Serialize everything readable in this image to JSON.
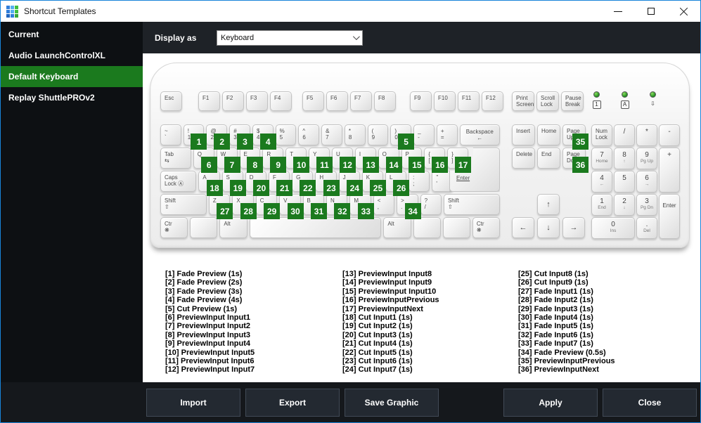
{
  "window": {
    "title": "Shortcut Templates"
  },
  "icon_squares": [
    "#2f7edb",
    "#55aef0",
    "#3fbf3f",
    "#2f7edb",
    "#55aef0",
    "#3fbf3f",
    "#1f66c0",
    "#2f7edb",
    "#37a837"
  ],
  "colors": {
    "accent_green": "#1b7a1e",
    "window_border": "#1884d9",
    "badge_green": "#1b7a1e"
  },
  "sidebar": {
    "items": [
      {
        "label": "Current",
        "selected": false
      },
      {
        "label": "Audio LaunchControlXL",
        "selected": false
      },
      {
        "label": "Default Keyboard",
        "selected": true
      },
      {
        "label": "Replay ShuttlePROv2",
        "selected": false
      }
    ]
  },
  "toolbar": {
    "display_as_label": "Display as",
    "display_as_value": "Keyboard"
  },
  "keyboard": {
    "esc": {
      "lines": [
        "Esc"
      ],
      "name": "esc"
    },
    "function_groups": [
      [
        {
          "lines": [
            "F1"
          ]
        },
        {
          "lines": [
            "F2"
          ]
        },
        {
          "lines": [
            "F3"
          ]
        },
        {
          "lines": [
            "F4"
          ]
        }
      ],
      [
        {
          "lines": [
            "F5"
          ]
        },
        {
          "lines": [
            "F6"
          ]
        },
        {
          "lines": [
            "F7"
          ]
        },
        {
          "lines": [
            "F8"
          ]
        }
      ],
      [
        {
          "lines": [
            "F9"
          ]
        },
        {
          "lines": [
            "F10"
          ]
        },
        {
          "lines": [
            "F11"
          ]
        },
        {
          "lines": [
            "F12"
          ]
        }
      ]
    ],
    "system_keys": [
      {
        "lines": [
          "Print",
          "Screen"
        ],
        "name": "print-screen"
      },
      {
        "lines": [
          "Scroll",
          "Lock"
        ],
        "name": "scroll-lock"
      },
      {
        "lines": [
          "Pause",
          "Break"
        ],
        "name": "pause-break"
      }
    ],
    "leds": [
      {
        "symbol": "1",
        "boxed": true,
        "name": "num-lock-led"
      },
      {
        "symbol": "A",
        "boxed": true,
        "name": "caps-lock-led"
      },
      {
        "symbol": "⇩",
        "boxed": false,
        "name": "scroll-lock-led"
      }
    ],
    "main_rows": [
      [
        {
          "lines": [
            "~",
            "`"
          ],
          "w": 1,
          "name": "backtick"
        },
        {
          "lines": [
            "!",
            "1"
          ],
          "w": 1,
          "badge": "1"
        },
        {
          "lines": [
            "@",
            "2"
          ],
          "w": 1,
          "badge": "2"
        },
        {
          "lines": [
            "#",
            "3"
          ],
          "w": 1,
          "badge": "3"
        },
        {
          "lines": [
            "$",
            "4"
          ],
          "w": 1,
          "badge": "4"
        },
        {
          "lines": [
            "%",
            "5"
          ],
          "w": 1
        },
        {
          "lines": [
            "^",
            "6"
          ],
          "w": 1
        },
        {
          "lines": [
            "&",
            "7"
          ],
          "w": 1
        },
        {
          "lines": [
            "*",
            "8"
          ],
          "w": 1
        },
        {
          "lines": [
            "(",
            "9"
          ],
          "w": 1
        },
        {
          "lines": [
            ")",
            "0"
          ],
          "w": 1,
          "badge": "5"
        },
        {
          "lines": [
            "_",
            "-"
          ],
          "w": 1,
          "name": "minus"
        },
        {
          "lines": [
            "+",
            "="
          ],
          "w": 1,
          "name": "equals"
        },
        {
          "lines": [
            "Backspace",
            "←"
          ],
          "w": 2,
          "center": true,
          "name": "backspace"
        }
      ],
      [
        {
          "lines": [
            "Tab",
            "⇆"
          ],
          "w": 1.5,
          "name": "tab"
        },
        {
          "lines": [
            "Q"
          ],
          "w": 1,
          "badge": "6"
        },
        {
          "lines": [
            "W"
          ],
          "w": 1,
          "badge": "7"
        },
        {
          "lines": [
            "E"
          ],
          "w": 1,
          "badge": "8"
        },
        {
          "lines": [
            "R"
          ],
          "w": 1,
          "badge": "9"
        },
        {
          "lines": [
            "T"
          ],
          "w": 1,
          "badge": "10"
        },
        {
          "lines": [
            "Y"
          ],
          "w": 1,
          "badge": "11"
        },
        {
          "lines": [
            "U"
          ],
          "w": 1,
          "badge": "12"
        },
        {
          "lines": [
            "I"
          ],
          "w": 1,
          "badge": "13"
        },
        {
          "lines": [
            "O"
          ],
          "w": 1,
          "badge": "14"
        },
        {
          "lines": [
            "P"
          ],
          "w": 1,
          "badge": "15"
        },
        {
          "lines": [
            "{",
            "["
          ],
          "w": 1,
          "badge": "16",
          "name": "lbracket"
        },
        {
          "lines": [
            "}",
            "]"
          ],
          "w": 1,
          "badge": "17",
          "name": "rbracket"
        },
        {
          "spacer": true,
          "w": 1.5
        }
      ],
      [
        {
          "lines": [
            "Caps",
            "Lock Ⓐ"
          ],
          "w": 1.75,
          "name": "caps-lock"
        },
        {
          "lines": [
            "A"
          ],
          "w": 1,
          "badge": "18"
        },
        {
          "lines": [
            "S"
          ],
          "w": 1,
          "badge": "19"
        },
        {
          "lines": [
            "D"
          ],
          "w": 1,
          "badge": "20"
        },
        {
          "lines": [
            "F"
          ],
          "w": 1,
          "badge": "21"
        },
        {
          "lines": [
            "G"
          ],
          "w": 1,
          "badge": "22"
        },
        {
          "lines": [
            "H"
          ],
          "w": 1,
          "badge": "23"
        },
        {
          "lines": [
            "J"
          ],
          "w": 1,
          "badge": "24"
        },
        {
          "lines": [
            "K"
          ],
          "w": 1,
          "badge": "25"
        },
        {
          "lines": [
            "L"
          ],
          "w": 1,
          "badge": "26"
        },
        {
          "lines": [
            ":",
            ";"
          ],
          "w": 1,
          "name": "semicolon"
        },
        {
          "lines": [
            "\"",
            "'"
          ],
          "w": 1,
          "name": "quote"
        },
        {
          "spacer": true,
          "w": 2.25
        }
      ],
      [
        {
          "lines": [
            "Shift",
            "⇧"
          ],
          "w": 2.25,
          "name": "left-shift"
        },
        {
          "lines": [
            "Z"
          ],
          "w": 1,
          "badge": "27"
        },
        {
          "lines": [
            "X"
          ],
          "w": 1,
          "badge": "28"
        },
        {
          "lines": [
            "C"
          ],
          "w": 1,
          "badge": "29"
        },
        {
          "lines": [
            "V"
          ],
          "w": 1,
          "badge": "30"
        },
        {
          "lines": [
            "B"
          ],
          "w": 1,
          "badge": "31"
        },
        {
          "lines": [
            "N"
          ],
          "w": 1,
          "badge": "32"
        },
        {
          "lines": [
            "M"
          ],
          "w": 1,
          "badge": "33"
        },
        {
          "lines": [
            "<",
            ","
          ],
          "w": 1,
          "name": "comma"
        },
        {
          "lines": [
            ">",
            "."
          ],
          "w": 1,
          "badge": "34",
          "name": "period"
        },
        {
          "lines": [
            "?",
            "/"
          ],
          "w": 1,
          "name": "slash"
        },
        {
          "lines": [
            "Shift",
            "⇧"
          ],
          "w": 2.75,
          "name": "right-shift"
        }
      ],
      [
        {
          "lines": [
            "Ctr",
            "❋"
          ],
          "w": 1.25,
          "name": "left-ctrl"
        },
        {
          "lines": [],
          "w": 1.25,
          "name": "left-win"
        },
        {
          "lines": [
            "Alt"
          ],
          "w": 1.25,
          "name": "left-alt"
        },
        {
          "lines": [],
          "w": 6.25,
          "name": "space"
        },
        {
          "lines": [
            "Alt"
          ],
          "w": 1.25,
          "name": "right-alt"
        },
        {
          "lines": [],
          "w": 1.25,
          "name": "right-win"
        },
        {
          "lines": [],
          "w": 1.25,
          "name": "menu"
        },
        {
          "lines": [
            "Ctr",
            "❋"
          ],
          "w": 1.25,
          "name": "right-ctrl"
        }
      ]
    ],
    "enter_label": "Enter",
    "nav_rows": [
      [
        {
          "lines": [
            "Insert"
          ]
        },
        {
          "lines": [
            "Home"
          ]
        },
        {
          "lines": [
            "Page",
            "Up"
          ],
          "badge": "35",
          "name": "page-up"
        }
      ],
      [
        {
          "lines": [
            "Delete"
          ]
        },
        {
          "lines": [
            "End"
          ]
        },
        {
          "lines": [
            "Page",
            "Down"
          ],
          "badge": "36",
          "name": "page-down"
        }
      ]
    ],
    "arrows": {
      "up": "↑",
      "left": "←",
      "down": "↓",
      "right": "→"
    },
    "numpad": [
      {
        "lines": [
          "Num",
          "Lock"
        ],
        "r": 1,
        "c": 1,
        "name": "num-lock"
      },
      {
        "big": "/",
        "r": 1,
        "c": 2,
        "name": "numpad-divide"
      },
      {
        "big": "*",
        "r": 1,
        "c": 3,
        "name": "numpad-multiply"
      },
      {
        "big": "-",
        "r": 1,
        "c": 4,
        "name": "numpad-minus"
      },
      {
        "big": "7",
        "sub": "Home",
        "r": 2,
        "c": 1,
        "name": "numpad-7"
      },
      {
        "big": "8",
        "sub": "↑",
        "r": 2,
        "c": 2,
        "name": "numpad-8"
      },
      {
        "big": "9",
        "sub": "Pg Up",
        "r": 2,
        "c": 3,
        "name": "numpad-9"
      },
      {
        "big": "+",
        "r": 2,
        "c": 4,
        "rs": 2,
        "name": "numpad-plus"
      },
      {
        "big": "4",
        "sub": "←",
        "r": 3,
        "c": 1,
        "name": "numpad-4"
      },
      {
        "big": "5",
        "r": 3,
        "c": 2,
        "name": "numpad-5"
      },
      {
        "big": "6",
        "sub": "→",
        "r": 3,
        "c": 3,
        "name": "numpad-6"
      },
      {
        "big": "1",
        "sub": "End",
        "r": 4,
        "c": 1,
        "name": "numpad-1"
      },
      {
        "big": "2",
        "sub": "↓",
        "r": 4,
        "c": 2,
        "name": "numpad-2"
      },
      {
        "big": "3",
        "sub": "Pg Dn",
        "r": 4,
        "c": 3,
        "name": "numpad-3"
      },
      {
        "big": "Enter",
        "small": true,
        "r": 4,
        "c": 4,
        "rs": 2,
        "name": "numpad-enter"
      },
      {
        "big": "0",
        "sub": "Ins",
        "r": 5,
        "c": 1,
        "cs": 2,
        "name": "numpad-0"
      },
      {
        "big": ".",
        "sub": "Del",
        "r": 5,
        "c": 3,
        "name": "numpad-decimal"
      }
    ]
  },
  "legend": {
    "columns": [
      [
        "[1] Fade Preview (1s)",
        "[2] Fade Preview (2s)",
        "[3] Fade Preview (3s)",
        "[4] Fade Preview (4s)",
        "[5] Cut Preview (1s)",
        "[6] PreviewInput Input1",
        "[7] PreviewInput Input2",
        "[8] PreviewInput Input3",
        "[9] PreviewInput Input4",
        "[10] PreviewInput Input5",
        "[11] PreviewInput Input6",
        "[12] PreviewInput Input7"
      ],
      [
        "[13] PreviewInput Input8",
        "[14] PreviewInput Input9",
        "[15] PreviewInput Input10",
        "[16] PreviewInputPrevious",
        "[17] PreviewInputNext",
        "[18] Cut Input1 (1s)",
        "[19] Cut Input2 (1s)",
        "[20] Cut Input3 (1s)",
        "[21] Cut Input4 (1s)",
        "[22] Cut Input5 (1s)",
        "[23] Cut Input6 (1s)",
        "[24] Cut Input7 (1s)"
      ],
      [
        "[25] Cut Input8 (1s)",
        "[26] Cut Input9 (1s)",
        "[27] Fade Input1 (1s)",
        "[28] Fade Input2 (1s)",
        "[29] Fade Input3 (1s)",
        "[30] Fade Input4 (1s)",
        "[31] Fade Input5 (1s)",
        "[32] Fade Input6 (1s)",
        "[33] Fade Input7 (1s)",
        "[34] Fade Preview (0.5s)",
        "[35] PreviewInputPrevious",
        "[36] PreviewInputNext"
      ]
    ]
  },
  "footer": {
    "buttons": [
      {
        "label": "Import"
      },
      {
        "label": "Export"
      },
      {
        "label": "Save Graphic"
      },
      {
        "label": "Apply"
      },
      {
        "label": "Close"
      }
    ]
  }
}
